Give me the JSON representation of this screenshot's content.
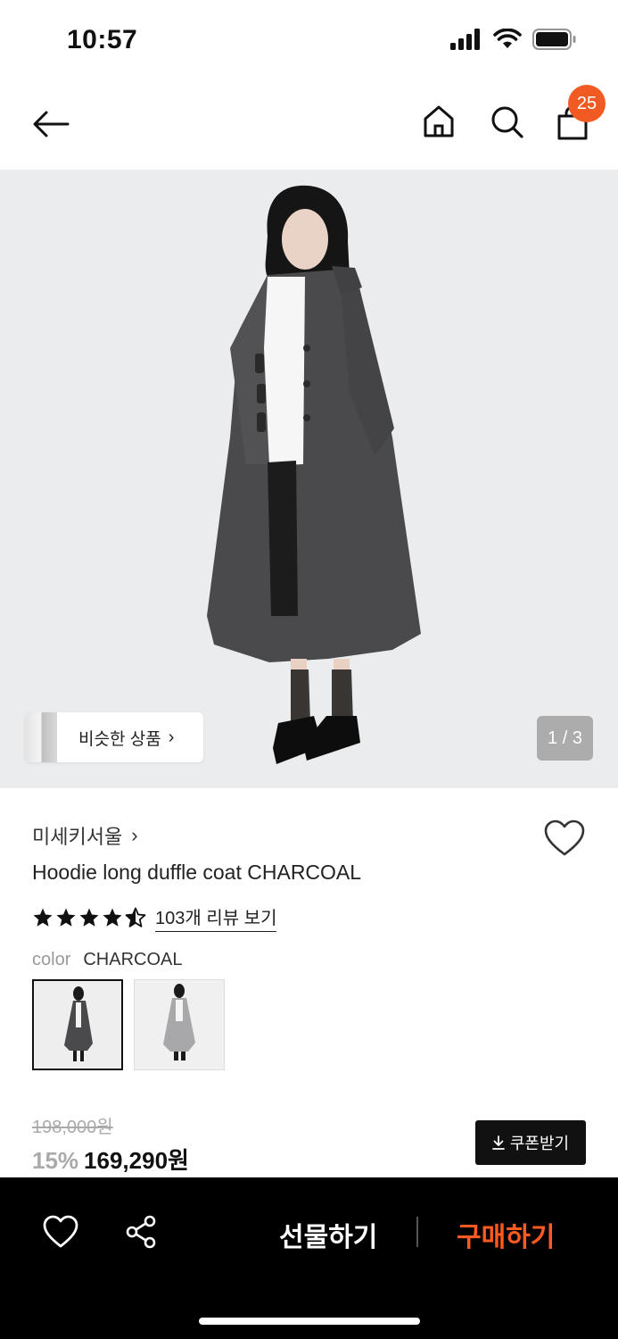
{
  "status_bar": {
    "time": "10:57",
    "icons": [
      "signal-icon",
      "wifi-icon",
      "battery-icon"
    ]
  },
  "header": {
    "icons": [
      "back-arrow-icon",
      "home-icon",
      "search-icon",
      "shopping-bag-icon"
    ],
    "cart_count": "25",
    "badge_color": "#f15a22"
  },
  "gallery": {
    "similar_label": "비슷한 상품",
    "similar_chevron": "›",
    "page_indicator": "1 / 3",
    "current_page": 1,
    "total_pages": 3
  },
  "product": {
    "brand": "미세키서울",
    "brand_chevron": "›",
    "name": "Hoodie long duffle coat CHARCOAL",
    "rating_stars": 4.5,
    "review_link": "103개 리뷰 보기",
    "color_key": "color",
    "color_value": "CHARCOAL",
    "color_options": [
      "charcoal-coat",
      "grey-coat"
    ],
    "selected_color_index": 0,
    "original_price": "198,000원",
    "discount": "15%",
    "price": "169,290원",
    "coupon_label": "쿠폰받기"
  },
  "bottom_bar": {
    "icons": [
      "heart-icon",
      "share-icon"
    ],
    "gift_label": "선물하기",
    "buy_label": "구매하기",
    "buy_color": "#ff5a1f"
  }
}
